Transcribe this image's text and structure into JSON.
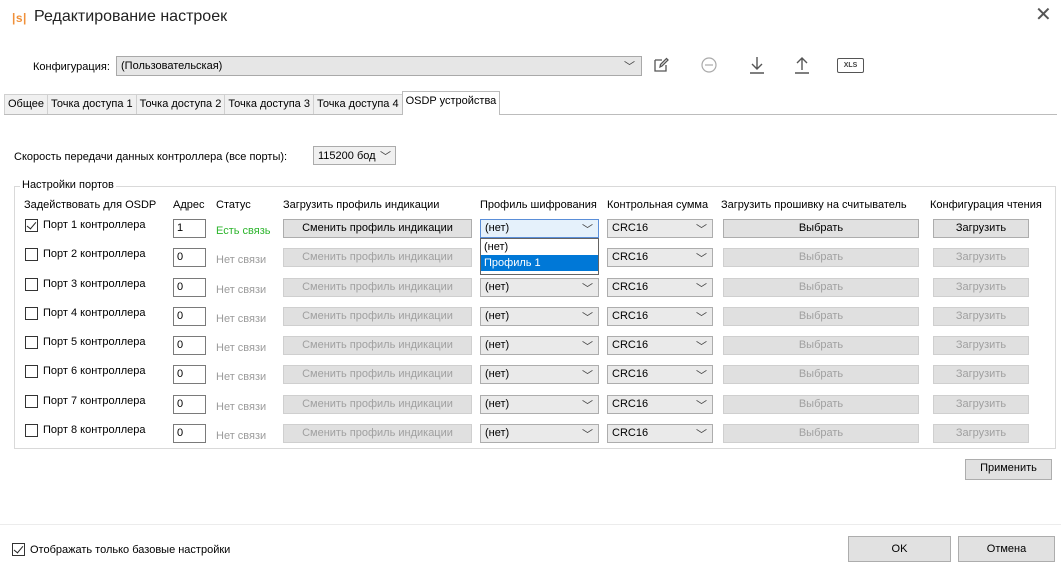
{
  "window": {
    "logo": "|s|",
    "title": "Редактирование настроек"
  },
  "config": {
    "label": "Конфигурация:",
    "value": "(Пользовательская)",
    "xls_label": "XLS"
  },
  "tabs": [
    {
      "label": "Общее"
    },
    {
      "label": "Точка доступа 1"
    },
    {
      "label": "Точка доступа 2"
    },
    {
      "label": "Точка доступа 3"
    },
    {
      "label": "Точка доступа 4"
    },
    {
      "label": "OSDP устройства",
      "active": true
    }
  ],
  "osdp": {
    "speed_label": "Скорость передачи данных контроллера (все порты):",
    "speed_value": "115200 бод",
    "group_title": "Настройки портов",
    "headers": {
      "use": "Задействовать для OSDP",
      "addr": "Адрес",
      "status": "Статус",
      "load_profile": "Загрузить профиль индикации",
      "cipher": "Профиль шифрования",
      "crc": "Контрольная сумма",
      "firmware": "Загрузить прошивку на считыватель",
      "read_cfg": "Конфигурация чтения"
    },
    "ports": [
      {
        "checked": true,
        "label": "Порт 1 контроллера",
        "address": "1",
        "status": "Есть связь",
        "connected": true,
        "profile_btn": "Сменить профиль индикации",
        "cipher": "(нет)",
        "crc": "CRC16",
        "fw_btn": "Выбрать",
        "read_btn": "Загрузить"
      },
      {
        "checked": false,
        "label": "Порт 2 контроллера",
        "address": "0",
        "status": "Нет связи",
        "connected": false,
        "profile_btn": "Сменить профиль индикации",
        "cipher": "(нет)",
        "crc": "CRC16",
        "fw_btn": "Выбрать",
        "read_btn": "Загрузить"
      },
      {
        "checked": false,
        "label": "Порт 3 контроллера",
        "address": "0",
        "status": "Нет связи",
        "connected": false,
        "profile_btn": "Сменить профиль индикации",
        "cipher": "(нет)",
        "crc": "CRC16",
        "fw_btn": "Выбрать",
        "read_btn": "Загрузить"
      },
      {
        "checked": false,
        "label": "Порт 4 контроллера",
        "address": "0",
        "status": "Нет связи",
        "connected": false,
        "profile_btn": "Сменить профиль индикации",
        "cipher": "(нет)",
        "crc": "CRC16",
        "fw_btn": "Выбрать",
        "read_btn": "Загрузить"
      },
      {
        "checked": false,
        "label": "Порт 5 контроллера",
        "address": "0",
        "status": "Нет связи",
        "connected": false,
        "profile_btn": "Сменить профиль индикации",
        "cipher": "(нет)",
        "crc": "CRC16",
        "fw_btn": "Выбрать",
        "read_btn": "Загрузить"
      },
      {
        "checked": false,
        "label": "Порт 6 контроллера",
        "address": "0",
        "status": "Нет связи",
        "connected": false,
        "profile_btn": "Сменить профиль индикации",
        "cipher": "(нет)",
        "crc": "CRC16",
        "fw_btn": "Выбрать",
        "read_btn": "Загрузить"
      },
      {
        "checked": false,
        "label": "Порт 7 контроллера",
        "address": "0",
        "status": "Нет связи",
        "connected": false,
        "profile_btn": "Сменить профиль индикации",
        "cipher": "(нет)",
        "crc": "CRC16",
        "fw_btn": "Выбрать",
        "read_btn": "Загрузить"
      },
      {
        "checked": false,
        "label": "Порт 8 контроллера",
        "address": "0",
        "status": "Нет связи",
        "connected": false,
        "profile_btn": "Сменить профиль индикации",
        "cipher": "(нет)",
        "crc": "CRC16",
        "fw_btn": "Выбрать",
        "read_btn": "Загрузить"
      }
    ],
    "cipher_dropdown": {
      "options": [
        "(нет)",
        "Профиль 1"
      ],
      "highlighted": "Профиль 1"
    },
    "apply_label": "Применить"
  },
  "footer": {
    "basic_only_checked": true,
    "basic_only_label": "Отображать только базовые настройки",
    "ok_label": "OK",
    "cancel_label": "Отмена"
  },
  "icons": [
    "edit-icon",
    "remove-icon",
    "download-icon",
    "upload-icon",
    "xls-icon",
    "close-icon",
    "chevron-down-icon"
  ],
  "colors": {
    "accent": "#f0913a",
    "status_ok": "#2db52d",
    "status_off": "#9b9b9b",
    "selection": "#0078d7"
  }
}
